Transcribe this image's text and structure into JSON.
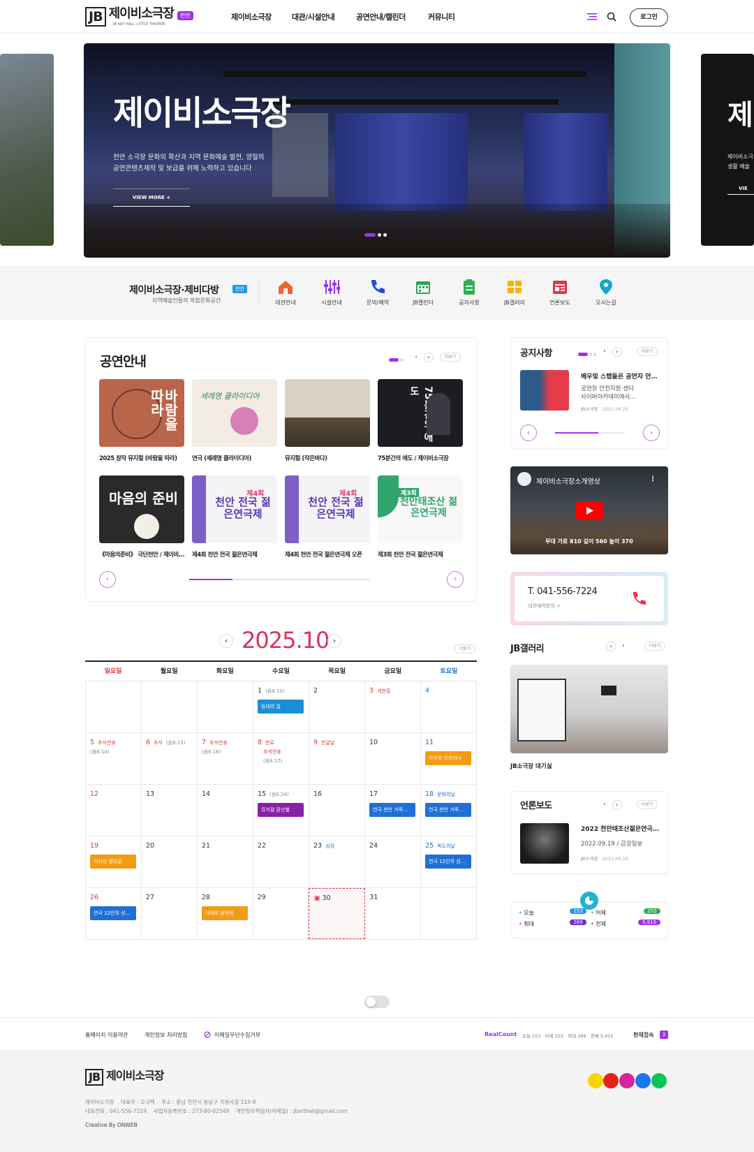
{
  "header": {
    "logo_jb": "JB",
    "logo_title": "제이비소극장",
    "logo_sub": "JB ART HALL, LITTLE THEATER",
    "logo_badge": "천안",
    "nav": [
      "제이비소극장",
      "대관/시설안내",
      "공연안내/캘린더",
      "커뮤니티"
    ],
    "login": "로그인"
  },
  "hero": {
    "title": "제이비소극장",
    "desc1": "천안 소극장 문화의 확산과 지역 문화예술 발전, 양질의",
    "desc2": "공연콘텐츠제작 및 보급을 위해 노력하고 있습니다",
    "btn": "VIEW MORE +",
    "right_title": "제",
    "right_desc1": "제이비소극",
    "right_desc2": "생활 예술",
    "right_btn": "VIE"
  },
  "quick": {
    "title": "제이비소극장·제비다방",
    "badge": "천안",
    "sub": "지역예술인들의 복합문화공간",
    "items": [
      {
        "label": "대관안내",
        "icon": "home-icon",
        "color": "#f06430"
      },
      {
        "label": "시설안내",
        "icon": "mixer-icon",
        "color": "#9b35e6"
      },
      {
        "label": "문의/예약",
        "icon": "phone-icon",
        "color": "#1f4fd6"
      },
      {
        "label": "JB캘린더",
        "icon": "calendar-icon",
        "color": "#2fa34e"
      },
      {
        "label": "공지사항",
        "icon": "clipboard-icon",
        "color": "#2fb04e"
      },
      {
        "label": "JB갤러리",
        "icon": "grid-icon",
        "color": "#f4b400"
      },
      {
        "label": "언론보도",
        "icon": "news-icon",
        "color": "#e8314e"
      },
      {
        "label": "오시는길",
        "icon": "location-icon",
        "color": "#17a8c7"
      }
    ]
  },
  "shows": {
    "title": "공연안내",
    "more": "더보기",
    "items": [
      {
        "caption": "2025 창작 뮤지컬 (바람을 따라)",
        "poster_text": "바람을 따라",
        "bg": "#b9654a"
      },
      {
        "caption": "연극 (세레명 클라이디아)",
        "poster_text": "세레명 클라이디아",
        "bg": "#f2ece4"
      },
      {
        "caption": "뮤지컬 (작은바다)",
        "poster_text": "",
        "bg": "#d9d2c4"
      },
      {
        "caption": "75분간의 애도 / 제이비소극장",
        "poster_text": "75분간의 애도",
        "bg": "#1c1c22"
      },
      {
        "caption": "《마음의준비》 극단천안 / 제이비소극장",
        "poster_text": "마음의 준비",
        "bg": "#2b2a2a"
      },
      {
        "caption": "제4회 천안 전국 젊은연극제",
        "poster_text": "천안 전국 젊은연극제",
        "bg": "#f4f4f6"
      },
      {
        "caption": "제4회 천안 전국 젊은연극제 오픈",
        "poster_text": "천안 전국 젊은연극제",
        "bg": "#f4f4f6"
      },
      {
        "caption": "제3회 천안 전국 젊은연극제",
        "poster_text": "천안태조산 젊은연극제",
        "bg": "#f8f8f8"
      }
    ],
    "badge4": "제4회",
    "badge3": "제3회"
  },
  "calendar": {
    "month": "2025.10",
    "more": "더보기",
    "days": [
      "일요일",
      "월요일",
      "화요일",
      "수요일",
      "목요일",
      "금요일",
      "토요일"
    ],
    "rows": [
      [
        {
          "d": ""
        },
        {
          "d": ""
        },
        {
          "d": ""
        },
        {
          "d": "1",
          "muted": "(음8.10)",
          "ev": {
            "t": "등대의 집",
            "c": "#1a8fd8"
          }
        },
        {
          "d": "2"
        },
        {
          "d": "3",
          "holi": "개천절"
        },
        {
          "d": "4"
        }
      ],
      [
        {
          "d": "5",
          "holi": "추석연휴",
          "muted2": "(음8.14)"
        },
        {
          "d": "6",
          "holi": "추석",
          "muted": "(음8.15)"
        },
        {
          "d": "7",
          "holi": "추석연휴",
          "muted2": "(음8.16)"
        },
        {
          "d": "8",
          "holi": "한로",
          "holi2": "추석연휴",
          "muted3": "(음8.17)"
        },
        {
          "d": "9",
          "holi": "한글날"
        },
        {
          "d": "10"
        },
        {
          "d": "11",
          "ev": {
            "t": "목수희 오카리나",
            "c": "#f39b12"
          }
        }
      ],
      [
        {
          "d": "12"
        },
        {
          "d": "13"
        },
        {
          "d": "14"
        },
        {
          "d": "15",
          "muted": "(음8.24)",
          "ev": {
            "t": "뮤지컬 환산별",
            "c": "#8a1fa8"
          }
        },
        {
          "d": "16"
        },
        {
          "d": "17",
          "ev": {
            "t": "연극 천안 가족…",
            "c": "#1f6fd6"
          }
        },
        {
          "d": "18",
          "blue": "문화의날",
          "ev": {
            "t": "연극 천안 가족…",
            "c": "#1f6fd6"
          }
        }
      ],
      [
        {
          "d": "19",
          "ev": {
            "t": "이지인 랜듀룬",
            "c": "#f39b12"
          }
        },
        {
          "d": "20"
        },
        {
          "d": "21"
        },
        {
          "d": "22"
        },
        {
          "d": "23",
          "blue": "상강"
        },
        {
          "d": "24"
        },
        {
          "d": "25",
          "blue": "독도의날",
          "ev": {
            "t": "연극 12인의 성…",
            "c": "#1f6fd6"
          }
        }
      ],
      [
        {
          "d": "26",
          "ev": {
            "t": "연극 12인의 성…",
            "c": "#1f6fd6"
          }
        },
        {
          "d": "27"
        },
        {
          "d": "28",
          "ev": {
            "t": "이태희 음악회",
            "c": "#f39b12"
          }
        },
        {
          "d": "29"
        },
        {
          "d": "30",
          "today": true
        },
        {
          "d": "31"
        },
        {
          "d": ""
        }
      ]
    ]
  },
  "notice": {
    "title": "공지사항",
    "more": "더보기",
    "item_title": "배우및 스탭들은 공연자 안…",
    "item_desc1": "공연장 안전지원 센터",
    "item_desc2": "사이버아카데미에서…",
    "item_meta": "JB소극장",
    "item_date": "2025.09.29"
  },
  "video": {
    "title": "제이비소극장소개영상",
    "caption": "무대 가로 810 깊이 560 높이 370"
  },
  "contact": {
    "phone": "T. 041-556-7224",
    "sub": "대관예약문의 >"
  },
  "gallery": {
    "title": "JB갤러리",
    "more": "더보기",
    "caption": "JB소극장 대기실"
  },
  "press": {
    "title": "언론보도",
    "more": "더보기",
    "item_title": "2022 천안태조산젊은연극…",
    "item_sub": "2022.09.19 / 금강일보",
    "item_meta": "JB소극장",
    "item_date": "2025.09.29"
  },
  "stats": {
    "today_label": "오늘",
    "today": "153",
    "yesterday_label": "어제",
    "yesterday": "252",
    "max_label": "최대",
    "max": "269",
    "total_label": "전체",
    "total": "5,915"
  },
  "footer": {
    "links": [
      "홈페이지 이용약관",
      "개인정보 처리방침",
      "이메일무단수집거부"
    ],
    "realcount": "RealCount",
    "rc_text": "오늘 153   어제 252   최대 269   전체 5,915",
    "now_label": "현재접속",
    "now": "3",
    "logo_title": "제이비소극장",
    "info1": "제이비소극장    대표자 : 오규택    주소 : 충남 천안시 동남구 각원사길 114-8",
    "info2": "대표전화 : 041-556-7224    사업자등록번호 : 273-80-02549    개인정보책임자(이메일) : jbarthall@gmail.com",
    "credit": "Creative By ONWEB",
    "sns": [
      {
        "name": "kakao-icon",
        "color": "#f7d300"
      },
      {
        "name": "youtube-icon",
        "color": "#e62117"
      },
      {
        "name": "instagram-icon",
        "color": "#d6249f"
      },
      {
        "name": "facebook-icon",
        "color": "#1877f2"
      },
      {
        "name": "line-icon",
        "color": "#06c755"
      }
    ]
  },
  "colors": {
    "accent": "#9b35e6",
    "red": "#d9325b"
  }
}
